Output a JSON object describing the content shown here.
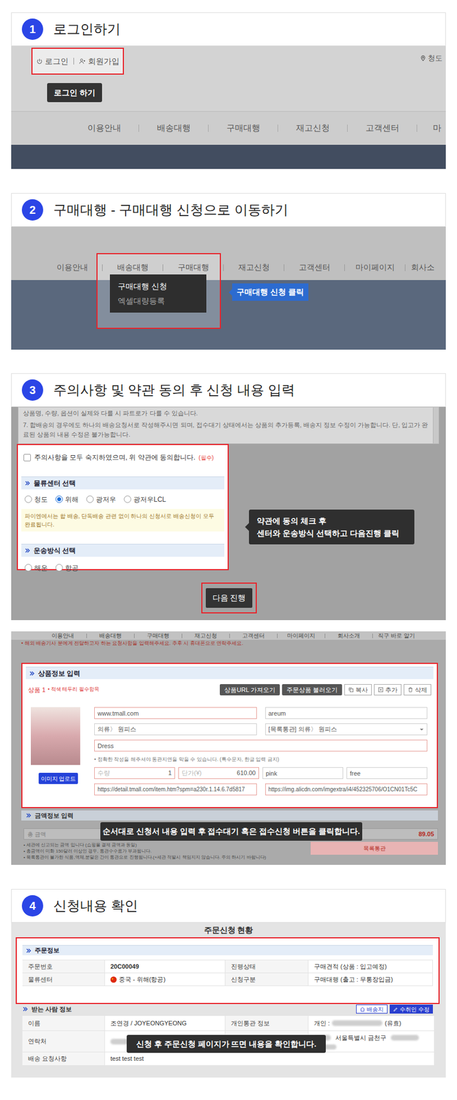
{
  "steps": [
    {
      "number": "1",
      "title": "로그인하기"
    },
    {
      "number": "2",
      "title": "구매대행 - 구매대행 신청으로 이동하기"
    },
    {
      "number": "3",
      "title": "주의사항 및 약관 동의 후 신청 내용 입력"
    },
    {
      "number": "4",
      "title": "신청내용 확인"
    }
  ],
  "login_shot": {
    "links": [
      {
        "label": "로그인"
      },
      {
        "label": "회원가입"
      }
    ],
    "location": "청도",
    "tooltip": "로그인 하기",
    "nav": [
      "이용안내",
      "배송대행",
      "구매대행",
      "재고신청",
      "고객센터",
      "마"
    ]
  },
  "menu_shot": {
    "nav": [
      "이용안내",
      "배송대행",
      "구매대행",
      "재고신청",
      "고객센터",
      "마이페이지",
      "회사소"
    ],
    "dropdown": [
      {
        "label": "구매대행 신청",
        "selected": true
      },
      {
        "label": "엑셀대량등록",
        "selected": false
      }
    ],
    "callout": "구매대행 신청 클릭"
  },
  "terms_shot": {
    "terms": [
      "상품명, 수량, 옵션이 실제와 다를 시 파트로가 다를 수 있습니다.",
      "7. 합배송의 경우에도 하나의 배송요청서로 작성해주시면 되며, 접수대기 상태에서는 상품의 추가등록, 배송지 정보 수정이 가능합니다. 단, 입고가 완료된 상품의 내용 수정은 불가능합니다."
    ],
    "agree": {
      "label": "주의사항을 모두 숙지하였으며, 위 약관에 동의합니다.",
      "required": "(필수)",
      "checked": false
    },
    "center": {
      "title": "물류센터 선택",
      "options": [
        {
          "label": "청도",
          "selected": false
        },
        {
          "label": "위해",
          "selected": true
        },
        {
          "label": "광저우",
          "selected": false
        },
        {
          "label": "광저우LCL",
          "selected": false
        }
      ],
      "note": "파이엔에서는 합 배송, 단독배송 관련 없이 하나의 신청서로 배송신청이 모두 완료됩니다."
    },
    "transport": {
      "title": "운송방식 선택",
      "options": [
        {
          "label": "해운",
          "selected": false
        },
        {
          "label": "항공",
          "selected": false
        }
      ]
    },
    "callout": [
      "약관에 동의 체크 후",
      "센터와 운송방식 선택하고 다음진행 클릭"
    ],
    "next_button": "다음 진행"
  },
  "product_shot": {
    "nav": [
      "이용안내",
      "배송대행",
      "구매대행",
      "재고신청",
      "고객센터",
      "마이페이지",
      "회사소개",
      "직구 바로 알기"
    ],
    "top_note": "• 해외 배송기사 분에게 전달하고자 하는 요청사항을 입력해주세요. 추후 시 휴대폰으로 연락주세요.",
    "title": "상품정보 입력",
    "item_label": "상품 1",
    "required_note": "• 적색 테두리 필수항목",
    "buttons": [
      {
        "label": "상품URL 가져오기",
        "kind": "dark"
      },
      {
        "label": "주문상품 불러오기",
        "kind": "dark"
      },
      {
        "label": "복사",
        "kind": "light"
      },
      {
        "label": "추가",
        "kind": "light"
      },
      {
        "label": "삭제",
        "kind": "light"
      }
    ],
    "upload": "이미지 업로드",
    "fields": {
      "shop": {
        "value": "www.tmall.com",
        "required": true
      },
      "orderer": {
        "value": "areum",
        "required": false
      },
      "category": {
        "value": "의류〉 원피스",
        "required": false
      },
      "customs": {
        "value": "[목록통관] 의류〉 원피스",
        "required": false
      },
      "name": {
        "value": "Dress",
        "required": true
      },
      "quantity": {
        "label": "수량",
        "value": "1",
        "required": true
      },
      "price": {
        "label": "단가(¥)",
        "value": "610.00",
        "required": true
      },
      "color": {
        "value": "pink",
        "required": false
      },
      "size": {
        "value": "free",
        "required": false
      },
      "url": {
        "value": "https://detail.tmall.com/item.htm?spm=a230r.1.14.6.7d5817",
        "required": true
      },
      "image_url": {
        "value": "https://img.alicdn.com/imgextra/i4/452325706/O1CN01Tc5C",
        "required": true
      }
    },
    "field_note": "• 정확한 작성을 해주셔야 통관지연을 막을 수 있습니다. (특수문자, 한글 입력 금지)",
    "amount_title": "금액정보 입력",
    "total_label": "총 금액",
    "total_value": "89.05",
    "amount_notes": [
      "• 세관에 신고되는 금액 입니다 (쇼핑몰 결제 금액과 동일)",
      "• 총금액이 미화 150달러 이상인 경우, 통관수수료가 부과됩니다.",
      "• 목록통관이 불가한 식품,액체,분말은 간이 통관으로 진행됩니다.(+세관 적발시 책임지지 않습니다. 주의 하시기 바랍니다)"
    ],
    "customs_button": "목록통관",
    "callout": "순서대로 신청서 내용 입력 후 접수대기 혹은 접수신청 버튼을 클릭합니다."
  },
  "order_shot": {
    "title": "주문신청 현황",
    "order_title": "주문정보",
    "order_rows": [
      [
        "주문번호",
        "20C00049",
        "진행상태",
        "구매견적 (상품 : 입고예정)"
      ],
      [
        "물류센터",
        "중국 - 위해(항공)",
        "신청구분",
        "구매대행 (출고 : 무통장입금)"
      ]
    ],
    "recipient_title": "받는 사람 정보",
    "recipient_buttons": [
      "배송지",
      "수취인 수정"
    ],
    "recipient": {
      "name_label": "이름",
      "name": "조연경 / JOYEONGYEONG",
      "customs_label": "개인통관 정보",
      "customs_prefix": "개인 :",
      "customs_suffix": "(유효)",
      "phone_label": "연락처",
      "address": "서울특별시 금천구",
      "request_label": "배송 요청사항",
      "request": "test test test"
    },
    "callout": "신청 후 주문신청 페이지가 뜨면 내용을 확인합니다."
  }
}
